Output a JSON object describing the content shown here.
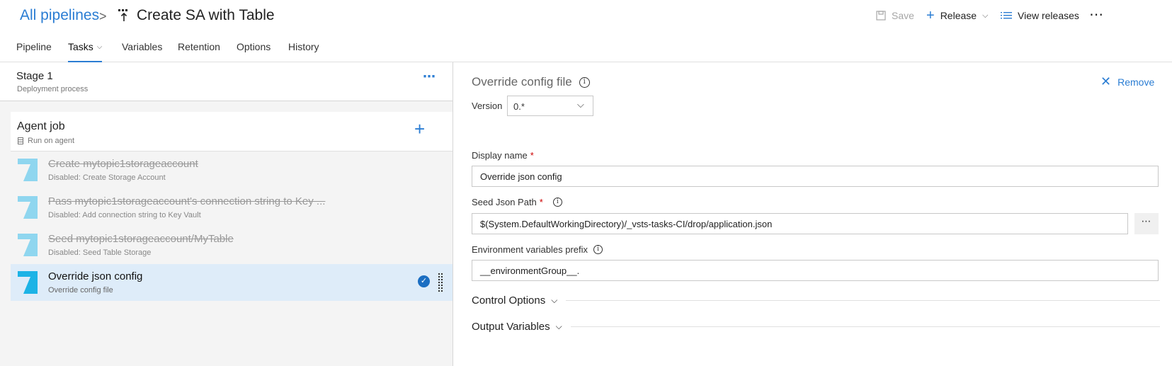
{
  "breadcrumb": {
    "all_pipelines": "All pipelines",
    "separator": ">",
    "title": "Create SA with Table"
  },
  "toolbar": {
    "save": "Save",
    "release": "Release",
    "view_releases": "View releases",
    "more": "⋯"
  },
  "tabs": [
    {
      "label": "Pipeline"
    },
    {
      "label": "Tasks",
      "active": true
    },
    {
      "label": "Variables"
    },
    {
      "label": "Retention"
    },
    {
      "label": "Options"
    },
    {
      "label": "History"
    }
  ],
  "stage": {
    "title": "Stage 1",
    "subtitle": "Deployment process",
    "more": "⋯"
  },
  "agent_job": {
    "title": "Agent job",
    "subtitle": "Run on agent",
    "add": "+"
  },
  "tasks": [
    {
      "title": "Create mytopic1storageaccount",
      "subtitle": "Disabled: Create Storage Account",
      "disabled": true
    },
    {
      "title": "Pass mytopic1storageaccount's connection string to Key ...",
      "subtitle": "Disabled: Add connection string to Key Vault",
      "disabled": true
    },
    {
      "title": "Seed mytopic1storageaccount/MyTable",
      "subtitle": "Disabled: Seed Table Storage",
      "disabled": true
    },
    {
      "title": "Override json config",
      "subtitle": "Override config file",
      "disabled": false,
      "selected": true
    }
  ],
  "detail": {
    "title": "Override config file",
    "remove": "Remove",
    "version_label": "Version",
    "version_value": "0.*",
    "display_name_label": "Display name",
    "display_name_value": "Override json config",
    "seed_json_path_label": "Seed Json Path",
    "seed_json_path_value": "$(System.DefaultWorkingDirectory)/_vsts-tasks-CI/drop/application.json",
    "env_prefix_label": "Environment variables prefix",
    "env_prefix_value": "__environmentGroup__.",
    "browse_button": "⋯",
    "required_marker": "*",
    "control_options": "Control Options",
    "output_variables": "Output Variables"
  },
  "colors": {
    "accent": "#2b7dd3",
    "selected_bg": "#deecf9",
    "task_icon": "#1cb3e6",
    "task_icon_disabled": "#8fd6ef"
  }
}
